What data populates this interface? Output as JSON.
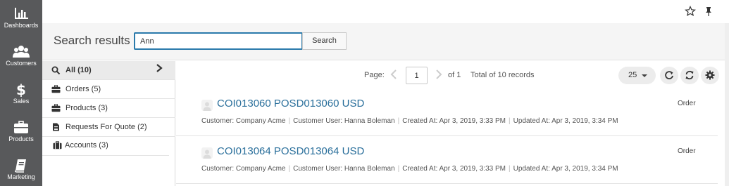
{
  "nav": {
    "items": [
      {
        "label": "Dashboards",
        "icon": "bar-chart-icon"
      },
      {
        "label": "Customers",
        "icon": "users-icon"
      },
      {
        "label": "Sales",
        "icon": "dollar-icon"
      },
      {
        "label": "Products",
        "icon": "briefcase-icon"
      },
      {
        "label": "Marketing",
        "icon": "book-icon"
      }
    ]
  },
  "topbar": {
    "icons": [
      "star-icon",
      "pin-icon"
    ]
  },
  "search": {
    "title": "Search results",
    "query": "Ann",
    "button_label": "Search"
  },
  "sidebar": {
    "items": [
      {
        "label": "All (10)",
        "icon": "search-icon",
        "active": true
      },
      {
        "label": "Orders (5)",
        "icon": "briefcase-icon"
      },
      {
        "label": "Products (3)",
        "icon": "briefcase-icon"
      },
      {
        "label": "Requests For Quote (2)",
        "icon": "document-icon"
      },
      {
        "label": "Accounts (3)",
        "icon": "suitcase-icon"
      }
    ]
  },
  "toolbar": {
    "page_label": "Page:",
    "page_value": "1",
    "of_label": "of 1",
    "total_label": "Total of 10 records",
    "per_page": "25"
  },
  "results": [
    {
      "title": "COI013060 POSD013060 USD",
      "type": "Order",
      "customer": "Customer: Company Acme",
      "customer_user": "Customer User: Hanna Boleman",
      "created": "Created At: Apr 3, 2019, 3:33 PM",
      "updated": "Updated At: Apr 3, 2019, 3:34 PM"
    },
    {
      "title": "COI013064 POSD013064 USD",
      "type": "Order",
      "customer": "Customer: Company Acme",
      "customer_user": "Customer User: Hanna Boleman",
      "created": "Created At: Apr 3, 2019, 3:33 PM",
      "updated": "Updated At: Apr 3, 2019, 3:34 PM"
    }
  ],
  "colors": {
    "nav_bg": "#58595b",
    "link": "#2a6f9b",
    "input_border": "#2a7aab"
  }
}
